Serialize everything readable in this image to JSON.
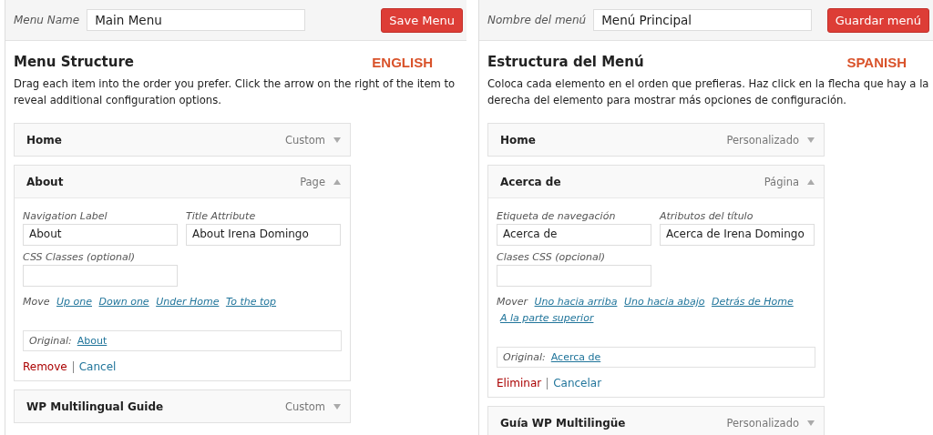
{
  "panels": [
    {
      "menu_name_label": "Menu Name",
      "menu_name": "Main Menu",
      "save_button": "Save Menu",
      "heading": "Menu Structure",
      "language": "ENGLISH",
      "description": "Drag each item into the order you prefer. Click the arrow on the right of the item to reveal additional configuration options.",
      "items": [
        {
          "title": "Home",
          "type": "Custom",
          "expanded": false
        },
        {
          "title": "About",
          "type": "Page",
          "expanded": true,
          "settings": {
            "nav_label_label": "Navigation Label",
            "nav_label": "About",
            "title_attr_label": "Title Attribute",
            "title_attr": "About Irena Domingo",
            "css_label": "CSS Classes (optional)",
            "move_label": "Move",
            "move_links": [
              "Up one",
              "Down one",
              "Under Home",
              "To the top"
            ],
            "original_label": "Original:",
            "original_link": "About",
            "remove": "Remove",
            "cancel": "Cancel"
          }
        },
        {
          "title": "WP Multilingual Guide",
          "type": "Custom",
          "expanded": false
        }
      ]
    },
    {
      "menu_name_label": "Nombre del menú",
      "menu_name": "Menú Principal",
      "save_button": "Guardar menú",
      "heading": "Estructura del Menú",
      "language": "SPANISH",
      "description": "Coloca cada elemento en el orden que prefieras. Haz click en la flecha que hay a la derecha del elemento para mostrar más opciones de configuración.",
      "items": [
        {
          "title": "Home",
          "type": "Personalizado",
          "expanded": false
        },
        {
          "title": "Acerca de",
          "type": "Página",
          "expanded": true,
          "settings": {
            "nav_label_label": "Etiqueta de navegación",
            "nav_label": "Acerca de",
            "title_attr_label": "Atributos del título",
            "title_attr": "Acerca de Irena Domingo",
            "css_label": "Clases CSS (opcional)",
            "move_label": "Mover",
            "move_links": [
              "Uno hacia arriba",
              "Uno hacia abajo",
              "Detrás de Home",
              "A la parte superior"
            ],
            "original_label": "Original:",
            "original_link": "Acerca de",
            "remove": "Eliminar",
            "cancel": "Cancelar"
          }
        },
        {
          "title": "Guía WP Multilingüe",
          "type": "Personalizado",
          "expanded": false
        }
      ]
    }
  ]
}
